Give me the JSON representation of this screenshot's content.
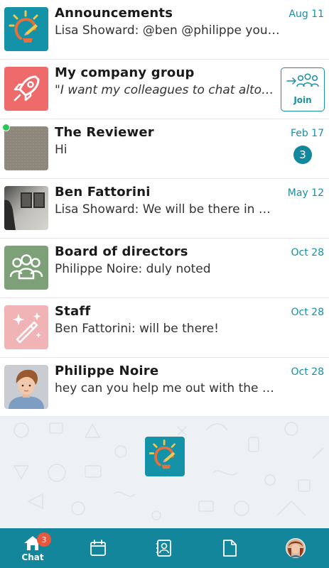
{
  "chats": [
    {
      "title": "Announcements",
      "preview": "Lisa Showard: @ben @philippe you …",
      "date": "Aug 11",
      "avatar": "lightbulb-logo-avatar"
    },
    {
      "title": "My company group",
      "preview": "\"I want my colleagues to chat alto…",
      "date": "",
      "avatar": "rocket-avatar",
      "join_label": "Join"
    },
    {
      "title": "The Reviewer",
      "preview": "Hi",
      "date": "Feb 17",
      "unread": "3",
      "avatar": "gray-photo-avatar"
    },
    {
      "title": "Ben Fattorini",
      "preview": "Lisa Showard: We will be there in …",
      "date": "May 12",
      "avatar": "wall-photo-avatar"
    },
    {
      "title": "Board of directors",
      "preview": "Philippe Noire: duly noted",
      "date": "Oct 28",
      "avatar": "group-avatar"
    },
    {
      "title": "Staff",
      "preview": "Ben Fattorini: will be there!",
      "date": "Oct 28",
      "avatar": "magic-wand-avatar"
    },
    {
      "title": "Philippe Noire",
      "preview": "hey can you help me out with the …",
      "date": "Oct 28",
      "avatar": "person-photo-avatar"
    }
  ],
  "tabs": {
    "chat_label": "Chat",
    "chat_badge": "3",
    "items": [
      "home-icon",
      "calendar-icon",
      "contacts-icon",
      "document-icon",
      "profile-avatar"
    ]
  },
  "colors": {
    "accent": "#13869c",
    "date": "#1a8fa3",
    "badge": "#e8583e",
    "online": "#2ec45a"
  }
}
